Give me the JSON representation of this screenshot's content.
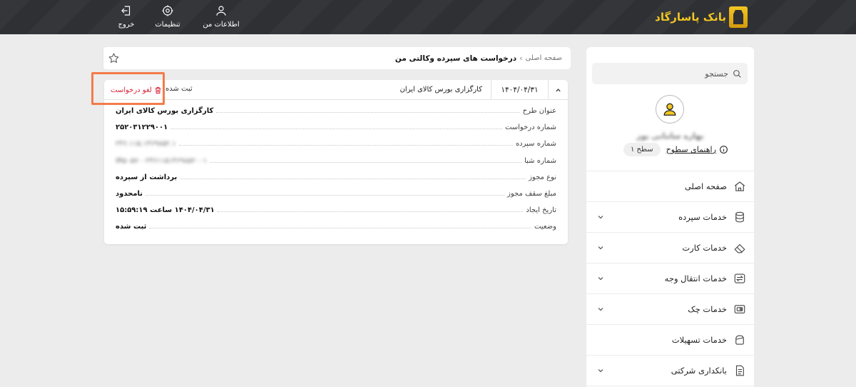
{
  "header": {
    "logo_text": "بانک پاسارگاد",
    "actions": [
      {
        "label": "اطلاعات من",
        "icon": "user-icon"
      },
      {
        "label": "تنظیمات",
        "icon": "gear-icon"
      },
      {
        "label": "خروج",
        "icon": "logout-icon"
      }
    ]
  },
  "sidebar": {
    "search_placeholder": "جستجو",
    "username": "بهاره سامانی پور",
    "guide_label": "راهنمای سطوح",
    "level_badge": "سطح ۱",
    "items": [
      {
        "label": "صفحه اصلی",
        "icon": "home-icon",
        "has_chevron": false
      },
      {
        "label": "خدمات سپرده",
        "icon": "coins-icon",
        "has_chevron": true
      },
      {
        "label": "خدمات کارت",
        "icon": "card-icon",
        "has_chevron": true
      },
      {
        "label": "خدمات انتقال وجه",
        "icon": "transfer-icon",
        "has_chevron": true
      },
      {
        "label": "خدمات چک",
        "icon": "cheque-icon",
        "has_chevron": true
      },
      {
        "label": "خدمات تسهیلات",
        "icon": "facility-icon",
        "has_chevron": false
      },
      {
        "label": "بانکداری شرکتی",
        "icon": "document-icon",
        "has_chevron": true
      }
    ]
  },
  "breadcrumb": {
    "home": "صفحه اصلی",
    "separator": "›",
    "current": "درخواست های سپرده وکالتی من"
  },
  "request": {
    "header_date": "۱۴۰۴/۰۴/۳۱",
    "header_broker": "کارگزاری بورس کالای ایران",
    "header_status": "ثبت شده",
    "cancel_label": "لغو درخواست",
    "rows": [
      {
        "label": "عنوان طرح",
        "value": "کارگزاری بورس کالای ایران",
        "masked": false
      },
      {
        "label": "شماره درخواست",
        "value": "۲۵۲۰۳۱۲۲۹۰۰۱",
        "masked": false
      },
      {
        "label": "شماره سپرده",
        "value": "۲۴۶.۱۱۵.۱۴۶۹۸۵۲.۱",
        "masked": true
      },
      {
        "label": "شماره شبا",
        "value": "IR۵۰۵۷۰۰۲۴۶۱۱۵۱۴۶۹۸۵۲۰۰۱",
        "masked": true
      },
      {
        "label": "نوع مجوز",
        "value": "برداشت از سپرده",
        "masked": false
      },
      {
        "label": "مبلغ سقف مجوز",
        "value": "نامحدود",
        "masked": false
      },
      {
        "label": "تاریخ ایجاد",
        "value": "۱۴۰۴/۰۴/۳۱ ساعت ۱۵:۵۹:۱۹",
        "masked": false
      },
      {
        "label": "وضعیت",
        "value": "ثبت شده",
        "masked": false
      }
    ]
  },
  "colors": {
    "topbar": "#2e3033",
    "brand_gold": "#f3c623",
    "cancel_red": "#d8243a",
    "highlight_orange": "#f37b4a"
  }
}
